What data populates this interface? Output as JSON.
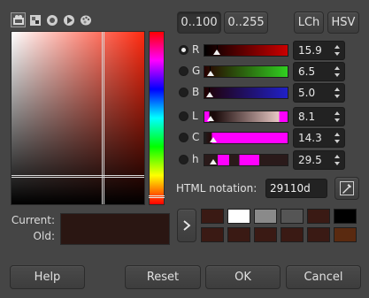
{
  "selector_tabs": [
    {
      "name": "gimp-selector-icon",
      "active": true
    },
    {
      "name": "cmyk-selector-icon",
      "active": false
    },
    {
      "name": "wheel-selector-icon",
      "active": false
    },
    {
      "name": "triangle-selector-icon",
      "active": false
    },
    {
      "name": "palette-selector-icon",
      "active": false
    }
  ],
  "range_buttons": {
    "r100": "0..100",
    "r255": "0..255"
  },
  "mode_buttons": {
    "lch": "LCh",
    "hsv": "HSV"
  },
  "channels": [
    {
      "label": "R",
      "value": "15.9",
      "selected": true
    },
    {
      "label": "G",
      "value": "6.5",
      "selected": false
    },
    {
      "label": "B",
      "value": "5.0",
      "selected": false
    },
    {
      "label": "L",
      "value": "8.1",
      "selected": false
    },
    {
      "label": "C",
      "value": "14.3",
      "selected": false
    },
    {
      "label": "h",
      "value": "29.5",
      "selected": false
    }
  ],
  "html_notation": {
    "label": "HTML notation:",
    "value": "29110d"
  },
  "current_label": "Current:",
  "old_label": "Old:",
  "current_color": "#2a1612",
  "history_swatches": [
    "#3a1a14",
    "#ffffff",
    "#8a8a8a",
    "#555555",
    "#3a1a14",
    "#000000",
    "#3a1a14",
    "#3a1a14",
    "#3a1a14",
    "#3a1a14",
    "#3a1a14",
    "#5a2a10"
  ],
  "buttons": {
    "help": "Help",
    "reset": "Reset",
    "ok": "OK",
    "cancel": "Cancel"
  }
}
